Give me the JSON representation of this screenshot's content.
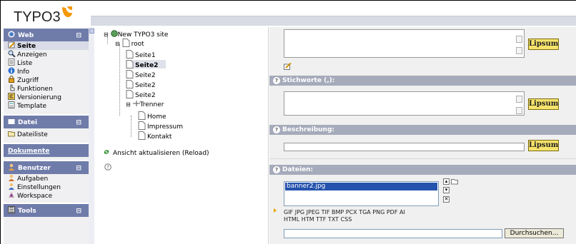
{
  "app": {
    "logo_text": "TYPO3"
  },
  "menu": {
    "web": {
      "title": "Web",
      "collapse": "⊟",
      "items": [
        "Seite",
        "Anzeigen",
        "Liste",
        "Info",
        "Zugriff",
        "Funktionen",
        "Versionierung",
        "Template"
      ]
    },
    "datei": {
      "title": "Datei",
      "collapse": "⊟",
      "items": [
        "Dateiliste"
      ]
    },
    "dokumente": {
      "title": "Dokumente"
    },
    "benutzer": {
      "title": "Benutzer",
      "collapse": "⊟",
      "items": [
        "Aufgaben",
        "Einstellungen",
        "Workspace"
      ]
    },
    "tools": {
      "title": "Tools",
      "collapse": "⊟"
    }
  },
  "tree": {
    "site": "New TYPO3 site",
    "root": "root",
    "nodes": [
      "Seite1",
      "Seite2",
      "Seite2",
      "Seite2",
      "Seite2"
    ],
    "separator": "Trenner",
    "children": [
      "Home",
      "Impressum",
      "Kontakt"
    ],
    "reload": "Ansicht aktualisieren (Reload)"
  },
  "form": {
    "lipsum": "Lipsum",
    "keywords_label": "Stichworte (,):",
    "description_label": "Beschreibung:",
    "files_label": "Dateien:",
    "file_item": "banner2.jpg",
    "file_types_line1": "GIF JPG JPEG TIF BMP PCX TGA PNG PDF AI",
    "file_types_line2": "HTML HTM TTF TXT CSS",
    "browse_button": "Durchsuchen..."
  }
}
